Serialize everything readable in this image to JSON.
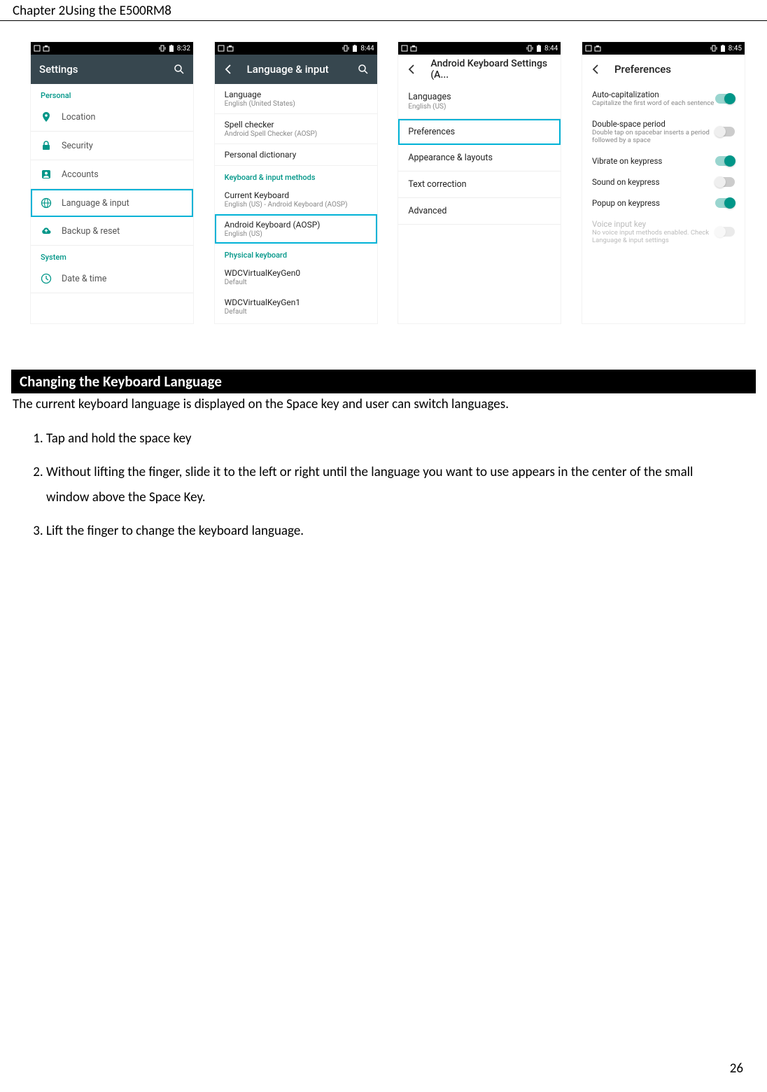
{
  "header": "Chapter 2Using the E500RM8",
  "page_number": "26",
  "section_title": "Changing the Keyboard Language",
  "intro": "The current keyboard language is displayed on the Space key and user can switch languages.",
  "steps": [
    "Tap and hold the space key",
    "Without lifting the finger, slide it to the left or right until the language you want to use appears in the center of the small window above the Space Key.",
    "Lift the finger to change the keyboard language."
  ],
  "shot1": {
    "time": "8:32",
    "title": "Settings",
    "section_personal": "Personal",
    "section_system": "System",
    "items_personal": [
      "Location",
      "Security",
      "Accounts",
      "Language & input",
      "Backup & reset"
    ],
    "items_system": [
      "Date & time"
    ]
  },
  "shot2": {
    "time": "8:44",
    "title": "Language & input",
    "items": [
      {
        "t1": "Language",
        "t2": "English (United States)"
      },
      {
        "t1": "Spell checker",
        "t2": "Android Spell Checker (AOSP)"
      },
      {
        "t1": "Personal dictionary",
        "t2": ""
      }
    ],
    "section_kbd": "Keyboard & input methods",
    "items_kbd": [
      {
        "t1": "Current Keyboard",
        "t2": "English (US) - Android Keyboard (AOSP)"
      },
      {
        "t1": "Android Keyboard (AOSP)",
        "t2": "English (US)"
      }
    ],
    "section_phys": "Physical keyboard",
    "items_phys": [
      {
        "t1": "WDCVirtualKeyGen0",
        "t2": "Default"
      },
      {
        "t1": "WDCVirtualKeyGen1",
        "t2": "Default"
      }
    ]
  },
  "shot3": {
    "time": "8:44",
    "title": "Android Keyboard Settings (A...",
    "items": [
      {
        "t1": "Languages",
        "t2": "English (US)"
      },
      {
        "t1": "Preferences",
        "t2": ""
      },
      {
        "t1": "Appearance & layouts",
        "t2": ""
      },
      {
        "t1": "Text correction",
        "t2": ""
      },
      {
        "t1": "Advanced",
        "t2": ""
      }
    ]
  },
  "shot4": {
    "time": "8:45",
    "title": "Preferences",
    "items": [
      {
        "t1": "Auto-capitalization",
        "t2": "Capitalize the first word of each sentence",
        "on": true
      },
      {
        "t1": "Double-space period",
        "t2": "Double tap on spacebar inserts a period followed by a space",
        "on": false
      },
      {
        "t1": "Vibrate on keypress",
        "t2": "",
        "on": true
      },
      {
        "t1": "Sound on keypress",
        "t2": "",
        "on": false
      },
      {
        "t1": "Popup on keypress",
        "t2": "",
        "on": true
      }
    ],
    "disabled": {
      "t1": "Voice input key",
      "t2": "No voice input methods enabled. Check Language & input settings",
      "on": false
    }
  }
}
